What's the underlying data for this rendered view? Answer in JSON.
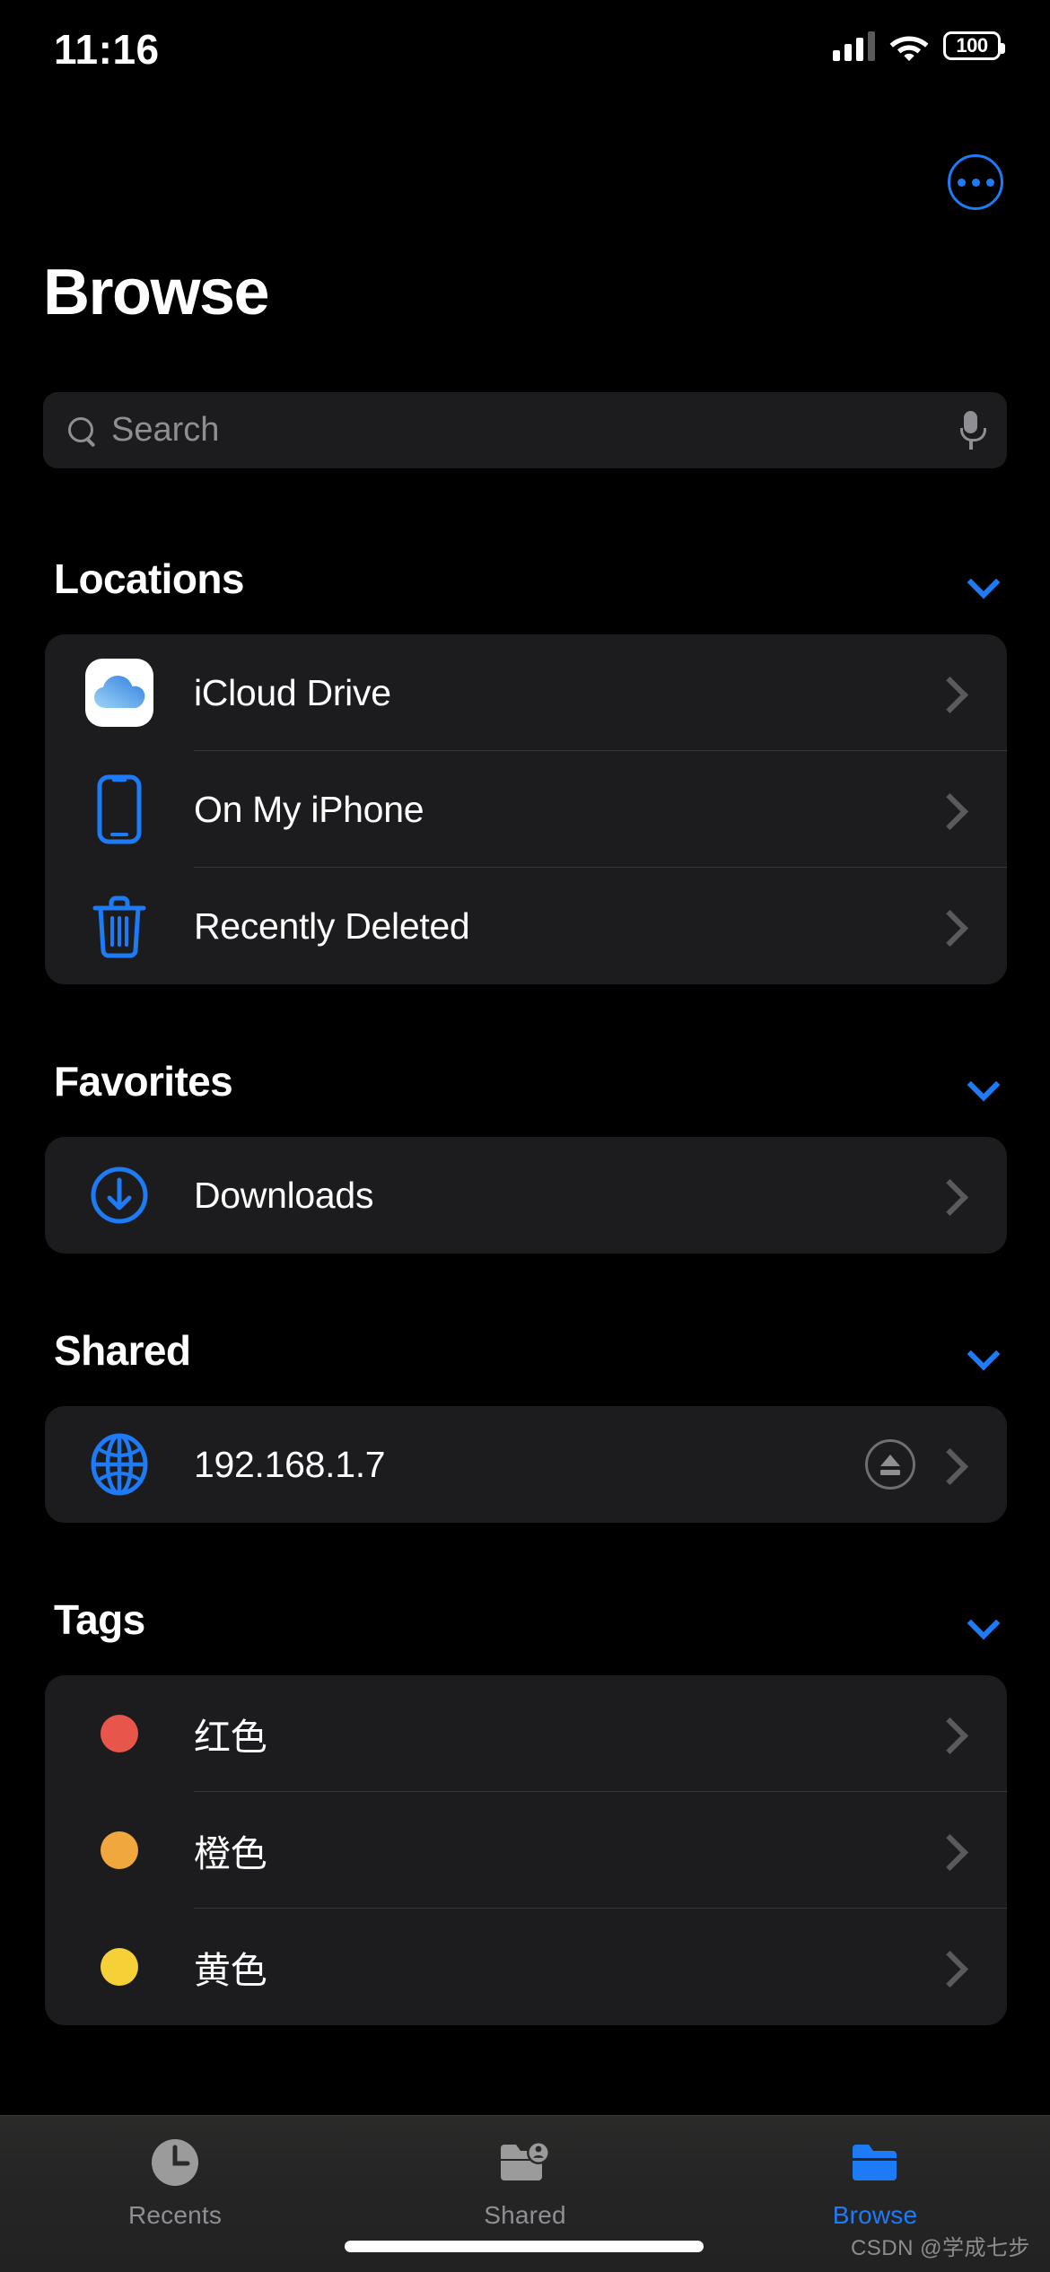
{
  "status_bar": {
    "time": "11:16",
    "battery_level": "100",
    "signal_icon": "cellular-bars-icon",
    "wifi_icon": "wifi-icon",
    "battery_icon": "battery-icon"
  },
  "header": {
    "title": "Browse",
    "more_button_icon": "ellipsis-circle-icon",
    "accent_color": "#1d7bf5"
  },
  "search": {
    "placeholder": "Search",
    "value": "",
    "search_icon": "search-icon",
    "mic_icon": "microphone-icon"
  },
  "sections": [
    {
      "title": "Locations",
      "collapse_icon": "chevron-down-icon",
      "items": [
        {
          "label": "iCloud Drive",
          "icon": "icloud-drive-icon",
          "chevron": "chevron-right-icon"
        },
        {
          "label": "On My iPhone",
          "icon": "iphone-icon",
          "chevron": "chevron-right-icon"
        },
        {
          "label": "Recently Deleted",
          "icon": "trash-icon",
          "chevron": "chevron-right-icon"
        }
      ]
    },
    {
      "title": "Favorites",
      "collapse_icon": "chevron-down-icon",
      "items": [
        {
          "label": "Downloads",
          "icon": "download-circle-icon",
          "chevron": "chevron-right-icon"
        }
      ]
    },
    {
      "title": "Shared",
      "collapse_icon": "chevron-down-icon",
      "items": [
        {
          "label": "192.168.1.7",
          "icon": "globe-icon",
          "eject_icon": "eject-icon",
          "chevron": "chevron-right-icon"
        }
      ]
    },
    {
      "title": "Tags",
      "collapse_icon": "chevron-down-icon",
      "items": [
        {
          "label": "红色",
          "icon": "tag-dot-icon",
          "color": "#e8554a",
          "chevron": "chevron-right-icon"
        },
        {
          "label": "橙色",
          "icon": "tag-dot-icon",
          "color": "#efa73e",
          "chevron": "chevron-right-icon"
        },
        {
          "label": "黄色",
          "icon": "tag-dot-icon",
          "color": "#f5d037",
          "chevron": "chevron-right-icon"
        }
      ]
    }
  ],
  "tab_bar": {
    "tabs": [
      {
        "label": "Recents",
        "icon": "clock-icon",
        "active": false
      },
      {
        "label": "Shared",
        "icon": "folder-person-icon",
        "active": false
      },
      {
        "label": "Browse",
        "icon": "folder-icon",
        "active": true
      }
    ],
    "active_color": "#1d7bf5",
    "inactive_color": "#8e8e93"
  },
  "watermark": "CSDN @学成七步"
}
